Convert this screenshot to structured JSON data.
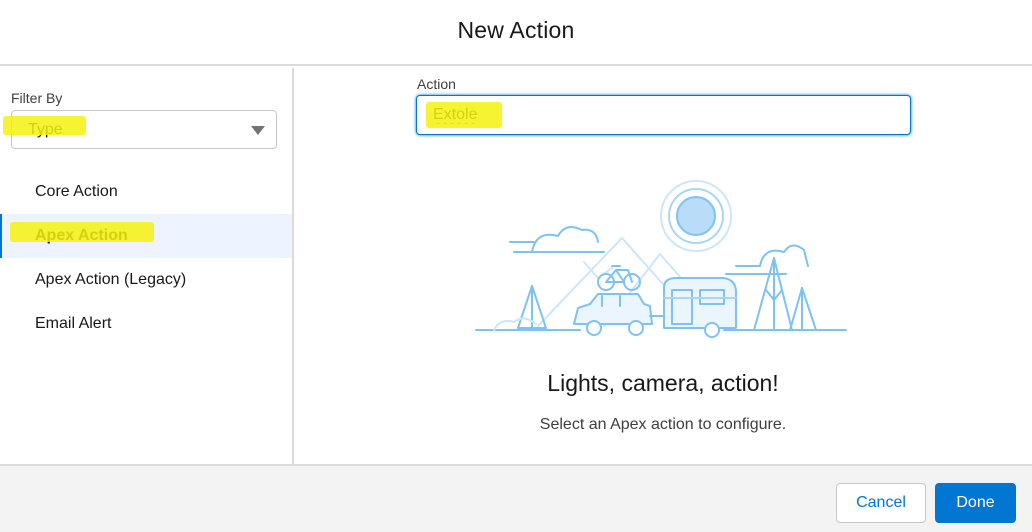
{
  "modal": {
    "title": "New Action"
  },
  "sidebar": {
    "filter_label": "Filter By",
    "filter_value": "Type",
    "items": [
      {
        "label": "Core Action",
        "active": false
      },
      {
        "label": "Apex Action",
        "active": true
      },
      {
        "label": "Apex Action (Legacy)",
        "active": false
      },
      {
        "label": "Email Alert",
        "active": false
      }
    ]
  },
  "main": {
    "action_label": "Action",
    "action_value": "Extole",
    "empty_title": "Lights, camera, action!",
    "empty_subtitle": "Select an Apex action to configure."
  },
  "footer": {
    "cancel_label": "Cancel",
    "done_label": "Done"
  },
  "colors": {
    "brand": "#0176d3",
    "highlight": "#f4f10e",
    "illustration": "#7ec2f2",
    "selected_bg": "#eef4ff"
  },
  "icons": {
    "select_caret": "chevron-down-icon",
    "illustration": "camping-scene-illustration"
  }
}
